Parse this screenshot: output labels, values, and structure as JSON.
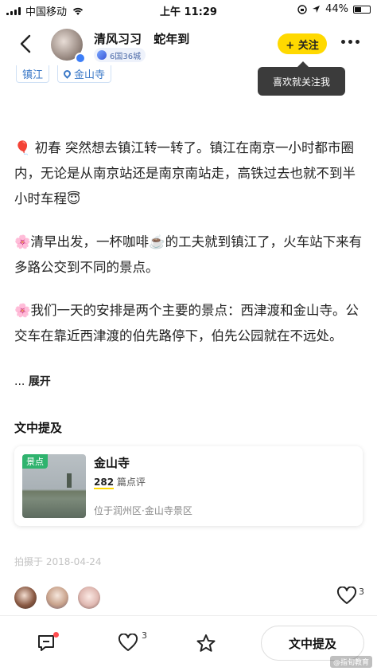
{
  "status_bar": {
    "carrier": "中国移动",
    "time": "上午 11:29",
    "battery": "44%"
  },
  "header": {
    "username": "清风习习",
    "subtitle": "蛇年到",
    "level_badge": "6国36城",
    "follow_label": "+ 关注",
    "tooltip": "喜欢就关注我"
  },
  "tags": {
    "city": "镇江",
    "place": "金山寺"
  },
  "article": {
    "paragraphs": [
      "🎈 初春 突然想去镇江转一转了。镇江在南京一小时都市圈内，无论是从南京站还是南京南站走，高铁过去也就不到半小时车程😇",
      "🌸清早出发，一杯咖啡☕️的工夫就到镇江了，火车站下来有多路公交到不同的景点。",
      "🌸我们一天的安排是两个主要的景点：西津渡和金山寺。公交车在靠近西津渡的伯先路停下，伯先公园就在不远处。"
    ],
    "expand_prefix": "...",
    "expand_label": "展开"
  },
  "mentions": {
    "title": "文中提及",
    "poi": {
      "badge": "景点",
      "name": "金山寺",
      "review_count": "282",
      "review_suffix": "篇点评",
      "location": "位于润州区·金山寺景区"
    }
  },
  "meta": {
    "date": "拍摄于 2018-04-24"
  },
  "likes": {
    "count": "3"
  },
  "bottom_bar": {
    "like_count": "3",
    "mention_button": "文中提及",
    "watermark": "@指旬教育"
  },
  "colors": {
    "accent_yellow": "#ffd900",
    "tag_blue": "#3a78c7",
    "poi_badge_green": "#2fb36e"
  }
}
